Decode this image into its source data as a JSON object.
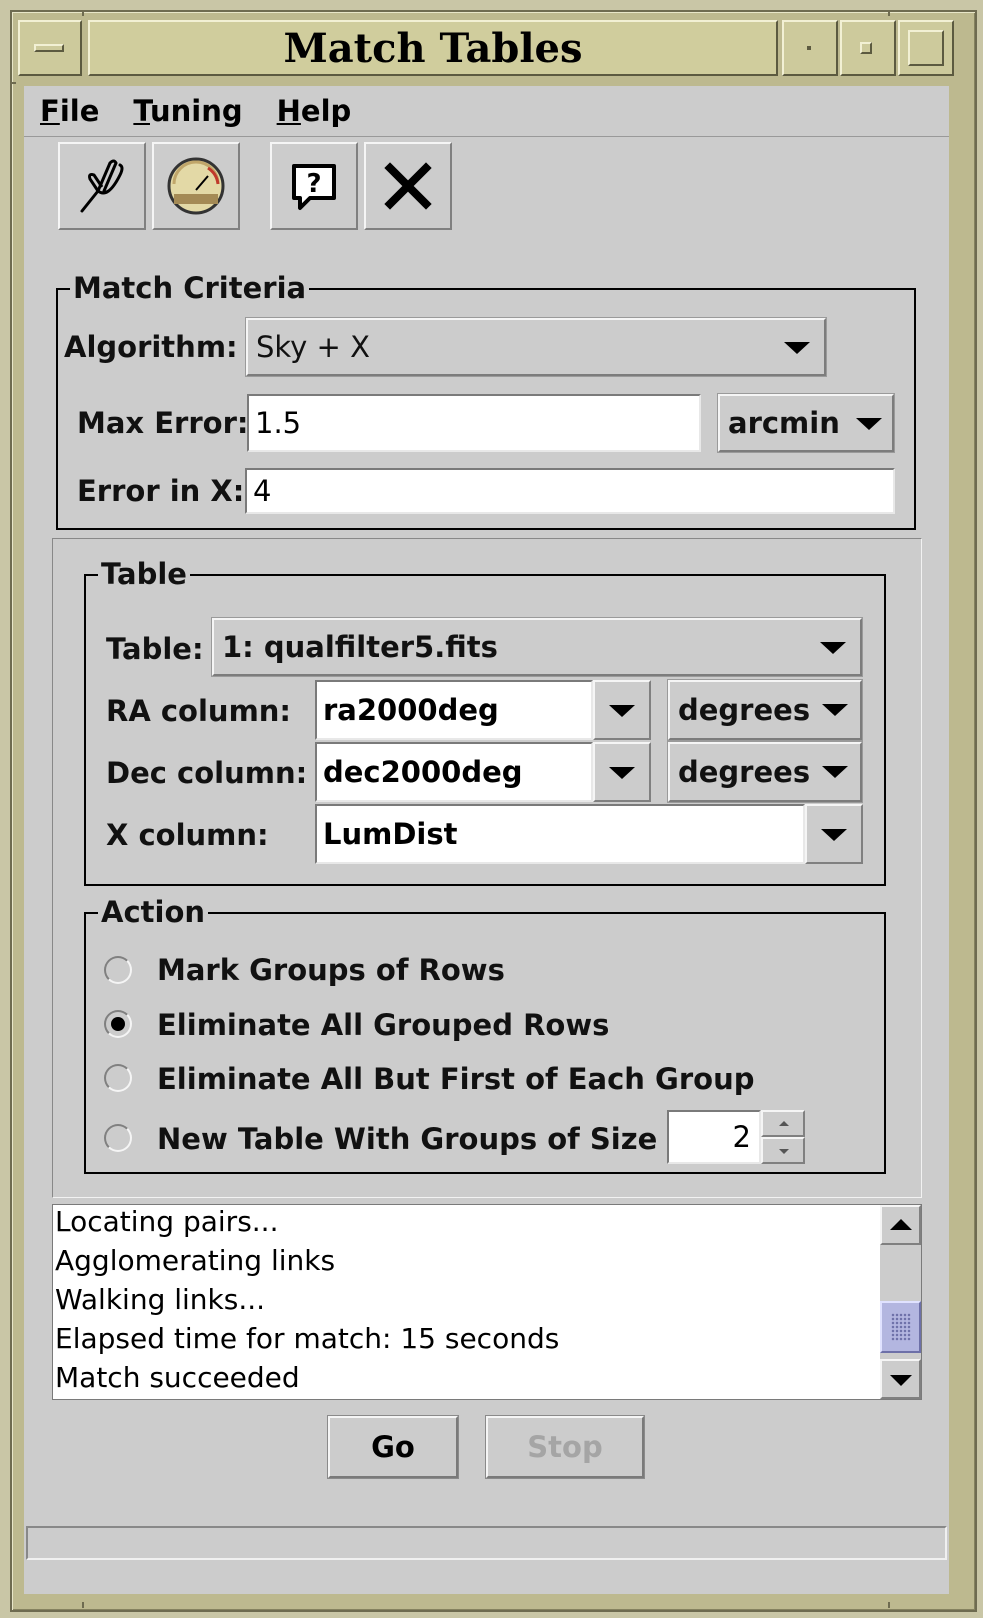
{
  "window": {
    "title": "Match Tables",
    "title_buttons": [
      "window-menu-button",
      "minimize-button",
      "maximize-button",
      "close-window-button"
    ]
  },
  "menubar": {
    "items": [
      {
        "label": "File",
        "mnemonic": "F",
        "rest": "ile"
      },
      {
        "label": "Tuning",
        "mnemonic": "T",
        "rest": "uning"
      },
      {
        "label": "Help",
        "mnemonic": "H",
        "rest": "elp"
      }
    ]
  },
  "toolbar": {
    "buttons": [
      "tuning-fork-icon",
      "gauge-icon",
      "help-icon",
      "close-icon"
    ]
  },
  "match_criteria": {
    "legend": "Match Criteria",
    "algorithm_label": "Algorithm:",
    "algorithm_value": "Sky + X",
    "max_error_label": "Max Error:",
    "max_error_value": "1.5",
    "max_error_unit": "arcmin",
    "error_x_label": "Error in X:",
    "error_x_value": "4"
  },
  "table_panel": {
    "legend": "Table",
    "table_label": "Table:",
    "table_value": "1: qualfilter5.fits",
    "ra_label": "RA column:",
    "ra_value": "ra2000deg",
    "ra_unit": "degrees",
    "dec_label": "Dec column:",
    "dec_value": "dec2000deg",
    "dec_unit": "degrees",
    "x_label": "X column:",
    "x_value": "LumDist"
  },
  "action_panel": {
    "legend": "Action",
    "options": [
      {
        "label": "Mark Groups of Rows",
        "selected": false
      },
      {
        "label": "Eliminate All Grouped Rows",
        "selected": true
      },
      {
        "label": "Eliminate All But First of Each Group",
        "selected": false
      },
      {
        "label": "New Table With Groups of Size",
        "selected": false
      }
    ],
    "group_size": "2"
  },
  "log": {
    "lines": [
      "Locating pairs...",
      "Agglomerating links",
      "Walking links...",
      "Elapsed time for match: 15 seconds",
      "Match succeeded"
    ]
  },
  "buttons": {
    "go": "Go",
    "stop": "Stop"
  }
}
